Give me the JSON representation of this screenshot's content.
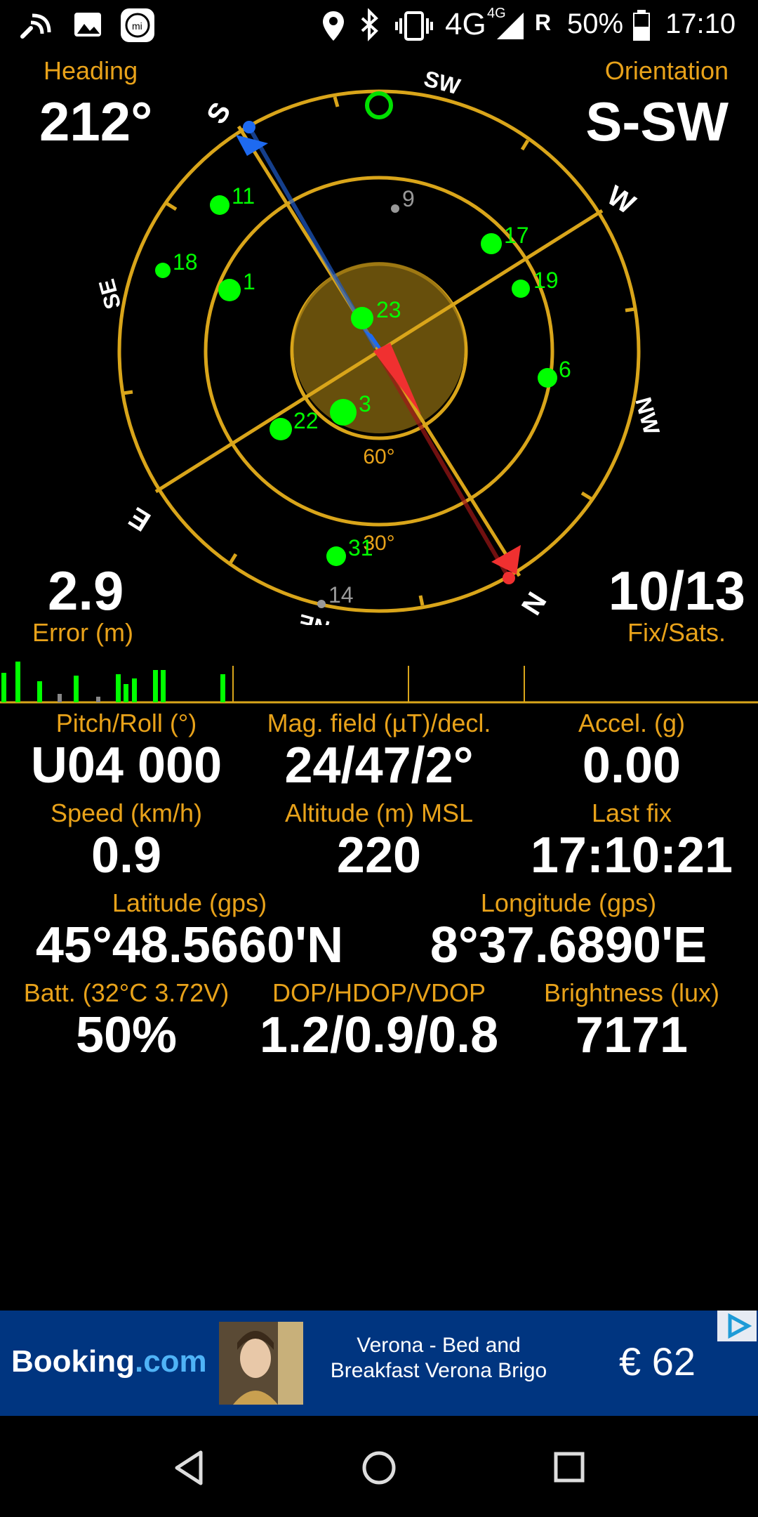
{
  "status_bar": {
    "network": "4G",
    "network_small": "4G",
    "roaming": "R",
    "battery": "50%",
    "time": "17:10"
  },
  "heading": {
    "label": "Heading",
    "value": "212°"
  },
  "orientation": {
    "label": "Orientation",
    "value": "S-SW"
  },
  "error": {
    "value": "2.9",
    "label": "Error (m)"
  },
  "fix_sats": {
    "value": "10/13",
    "label": "Fix/Sats."
  },
  "compass": {
    "cardinals": [
      "S",
      "SW",
      "W",
      "NW",
      "N",
      "NE",
      "E",
      "SE"
    ],
    "elev_labels": [
      "60°",
      "30°"
    ],
    "satellites": [
      {
        "id": "11",
        "color": "#00FF00"
      },
      {
        "id": "9",
        "color": "#999999"
      },
      {
        "id": "18",
        "color": "#00FF00"
      },
      {
        "id": "1",
        "color": "#00FF00"
      },
      {
        "id": "17",
        "color": "#00FF00"
      },
      {
        "id": "19",
        "color": "#00FF00"
      },
      {
        "id": "23",
        "color": "#00FF00"
      },
      {
        "id": "6",
        "color": "#00FF00"
      },
      {
        "id": "3",
        "color": "#00FF00"
      },
      {
        "id": "22",
        "color": "#00FF00"
      },
      {
        "id": "31",
        "color": "#00FF00"
      },
      {
        "id": "14",
        "color": "#999999"
      }
    ]
  },
  "info": {
    "pitch_roll": {
      "label": "Pitch/Roll (°)",
      "value": "U04 000"
    },
    "mag_field": {
      "label": "Mag. field (µT)/decl.",
      "value": "24/47/2°"
    },
    "accel": {
      "label": "Accel. (g)",
      "value": "0.00"
    },
    "speed": {
      "label": "Speed (km/h)",
      "value": "0.9"
    },
    "altitude": {
      "label": "Altitude (m) MSL",
      "value": "220"
    },
    "last_fix": {
      "label": "Last fix",
      "value": "17:10:21"
    },
    "latitude": {
      "label": "Latitude (gps)",
      "value": "45°48.5660'N"
    },
    "longitude": {
      "label": "Longitude (gps)",
      "value": "8°37.6890'E"
    },
    "battery": {
      "label": "Batt. (32°C 3.72V)",
      "value": "50%"
    },
    "dop": {
      "label": "DOP/HDOP/VDOP",
      "value": "1.2/0.9/0.8"
    },
    "brightness": {
      "label": "Brightness (lux)",
      "value": "7171"
    }
  },
  "ad": {
    "brand_main": "Booking",
    "brand_suffix": ".com",
    "line1": "Verona - Bed and",
    "line2": "Breakfast Verona Brigo",
    "price": "€ 62"
  },
  "colors": {
    "accent": "#E8A21A",
    "sat_green": "#00FF00",
    "ad_bg": "#003580"
  }
}
